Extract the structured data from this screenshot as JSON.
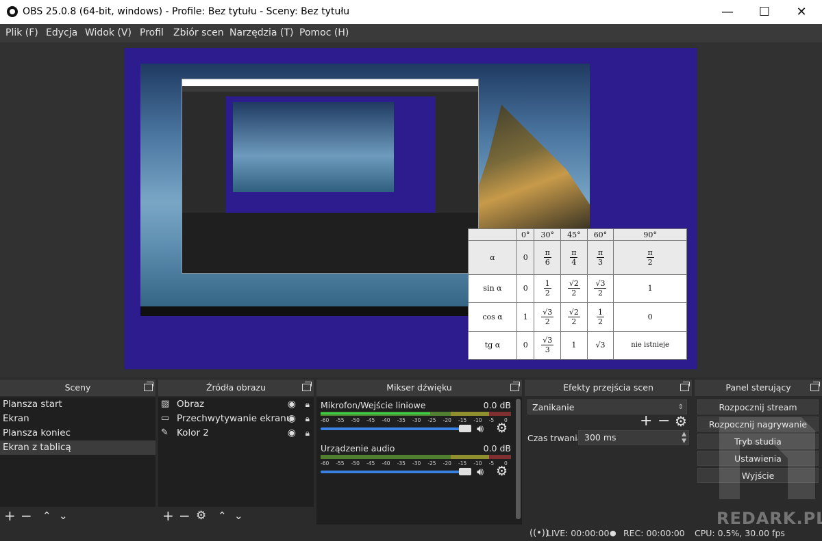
{
  "window": {
    "title": "OBS 25.0.8 (64-bit, windows) - Profile: Bez tytułu - Sceny: Bez tytułu",
    "minimize": "—",
    "maximize": "☐",
    "close": "✕"
  },
  "menu": [
    "Plik (F)",
    "Edycja",
    "Widok (V)",
    "Profil",
    "Zbiór scen",
    "Narzędzia (T)",
    "Pomoc (H)"
  ],
  "trig_table": {
    "angles": [
      "0°",
      "30°",
      "45°",
      "60°",
      "90°"
    ],
    "alpha_label": "α",
    "alpha_row": [
      {
        "v": "0"
      },
      {
        "num": "π",
        "den": "6"
      },
      {
        "num": "π",
        "den": "4"
      },
      {
        "num": "π",
        "den": "3"
      },
      {
        "num": "π",
        "den": "2"
      }
    ],
    "rows": [
      {
        "label": "sin α",
        "cells": [
          {
            "v": "0"
          },
          {
            "num": "1",
            "den": "2"
          },
          {
            "num": "√2",
            "den": "2"
          },
          {
            "num": "√3",
            "den": "2"
          },
          {
            "v": "1"
          }
        ]
      },
      {
        "label": "cos α",
        "cells": [
          {
            "v": "1"
          },
          {
            "num": "√3",
            "den": "2"
          },
          {
            "num": "√2",
            "den": "2"
          },
          {
            "num": "1",
            "den": "2"
          },
          {
            "v": "0"
          }
        ]
      },
      {
        "label": "tg α",
        "cells": [
          {
            "v": "0"
          },
          {
            "num": "√3",
            "den": "3"
          },
          {
            "v": "1"
          },
          {
            "v": "√3"
          },
          {
            "v": "nie istnieje"
          }
        ]
      }
    ]
  },
  "scenes": {
    "title": "Sceny",
    "items": [
      "Plansza start",
      "Ekran",
      "Plansza koniec",
      "Ekran z tablicą"
    ],
    "selected": 3
  },
  "sources": {
    "title": "Źródła obrazu",
    "items": [
      {
        "name": "Obraz",
        "icon": "image-icon"
      },
      {
        "name": "Przechwytywanie ekranu",
        "icon": "monitor-icon"
      },
      {
        "name": "Kolor 2",
        "icon": "brush-icon"
      }
    ]
  },
  "mixer": {
    "title": "Mikser dźwięku",
    "channels": [
      {
        "name": "Mikrofon/Wejście liniowe",
        "db": "0.0 dB"
      },
      {
        "name": "Urządzenie audio",
        "db": "0.0 dB"
      }
    ],
    "ticks": [
      "-60",
      "-55",
      "-50",
      "-45",
      "-40",
      "-35",
      "-30",
      "-25",
      "-20",
      "-15",
      "-10",
      "-5",
      "0"
    ]
  },
  "transitions": {
    "title": "Efekty przejścia scen",
    "selected": "Zanikanie",
    "duration_label": "Czas trwania",
    "duration_value": "300 ms"
  },
  "controls": {
    "title": "Panel sterujący",
    "buttons": [
      "Rozpocznij stream",
      "Rozpocznij nagrywanie",
      "Tryb studia",
      "Ustawienia",
      "Wyjście"
    ]
  },
  "status": {
    "live": "LIVE: 00:00:00",
    "rec": "REC: 00:00:00",
    "cpu": "CPU: 0.5%, 30.00 fps"
  },
  "watermark": "REDARK.PL",
  "colors": {
    "canvas_bg": "#2c1c8e",
    "panel_bg": "#2b2b2b",
    "accent_blue": "#3a82e2",
    "meter_green": "#39d045"
  }
}
